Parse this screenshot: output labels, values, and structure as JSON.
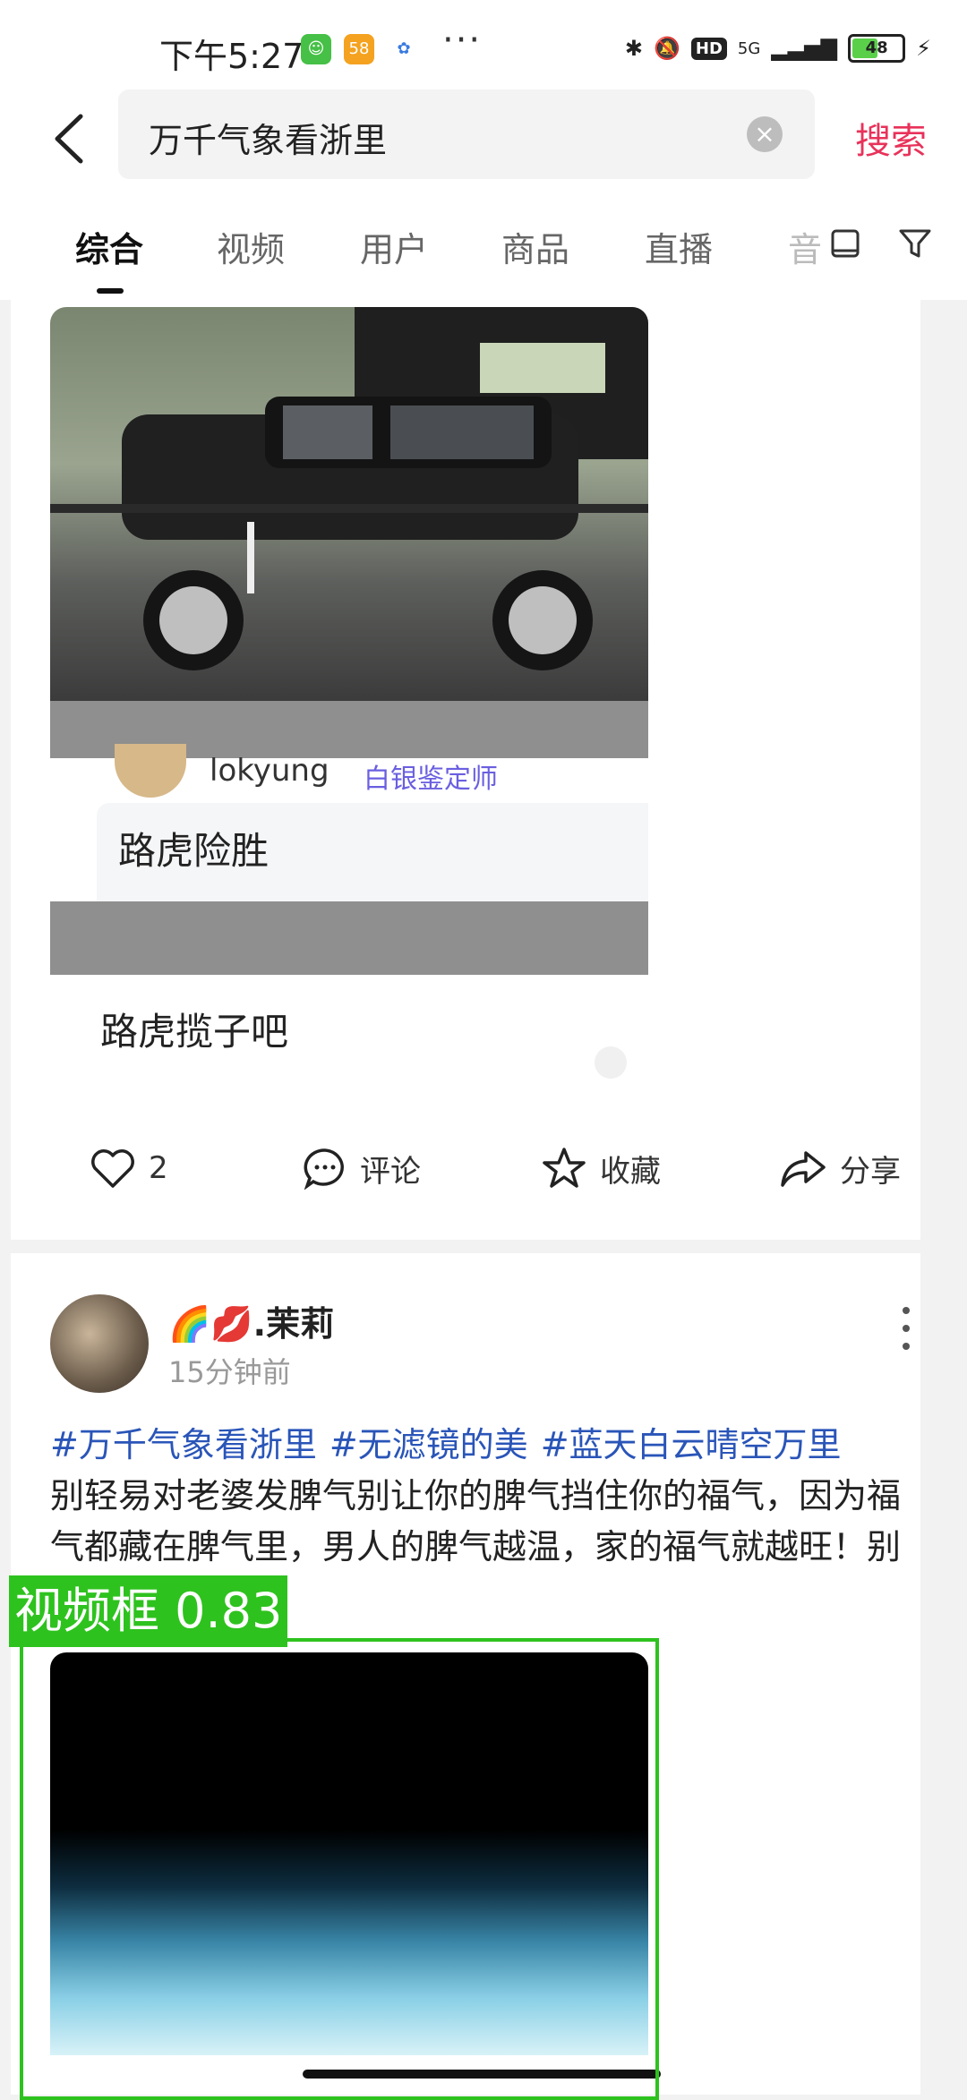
{
  "status_bar": {
    "time": "下午5:27",
    "app_icons": [
      "cat-app-icon",
      "58-app-icon",
      "cloud-app-icon"
    ],
    "dots": "···",
    "network": "5G",
    "battery": "48",
    "battery_level": 0.48
  },
  "search": {
    "query": "万千气象看浙里",
    "button_label": "搜索"
  },
  "tabs": [
    {
      "label": "综合",
      "active": true
    },
    {
      "label": "视频",
      "active": false
    },
    {
      "label": "用户",
      "active": false
    },
    {
      "label": "商品",
      "active": false
    },
    {
      "label": "直播",
      "active": false
    },
    {
      "label": "音",
      "active": false
    }
  ],
  "card1": {
    "comment1": {
      "name": "lokyung",
      "badge": "白银鉴定师",
      "text": "路虎险胜"
    },
    "comment2": {
      "text": "路虎揽子吧"
    },
    "actions": {
      "like_count": "2",
      "comment_label": "评论",
      "favorite_label": "收藏",
      "share_label": "分享"
    }
  },
  "card2": {
    "username": "🌈💋.茉莉",
    "time": "15分钟前",
    "hashtags": [
      "#万千气象看浙里",
      "#无滤镜的美",
      "#蓝天白云晴空万里"
    ],
    "body": "别轻易对老婆发脾气别让你的脾气挡住你的福气，因为福气都藏在脾气里，男人的脾气越温，家的福气就越旺！别再乱发脾气",
    "detection_label": "视频框 0.83"
  },
  "colors": {
    "accent": "#e8325a",
    "hashtag": "#2a55b8",
    "detection": "#2ec21e"
  }
}
